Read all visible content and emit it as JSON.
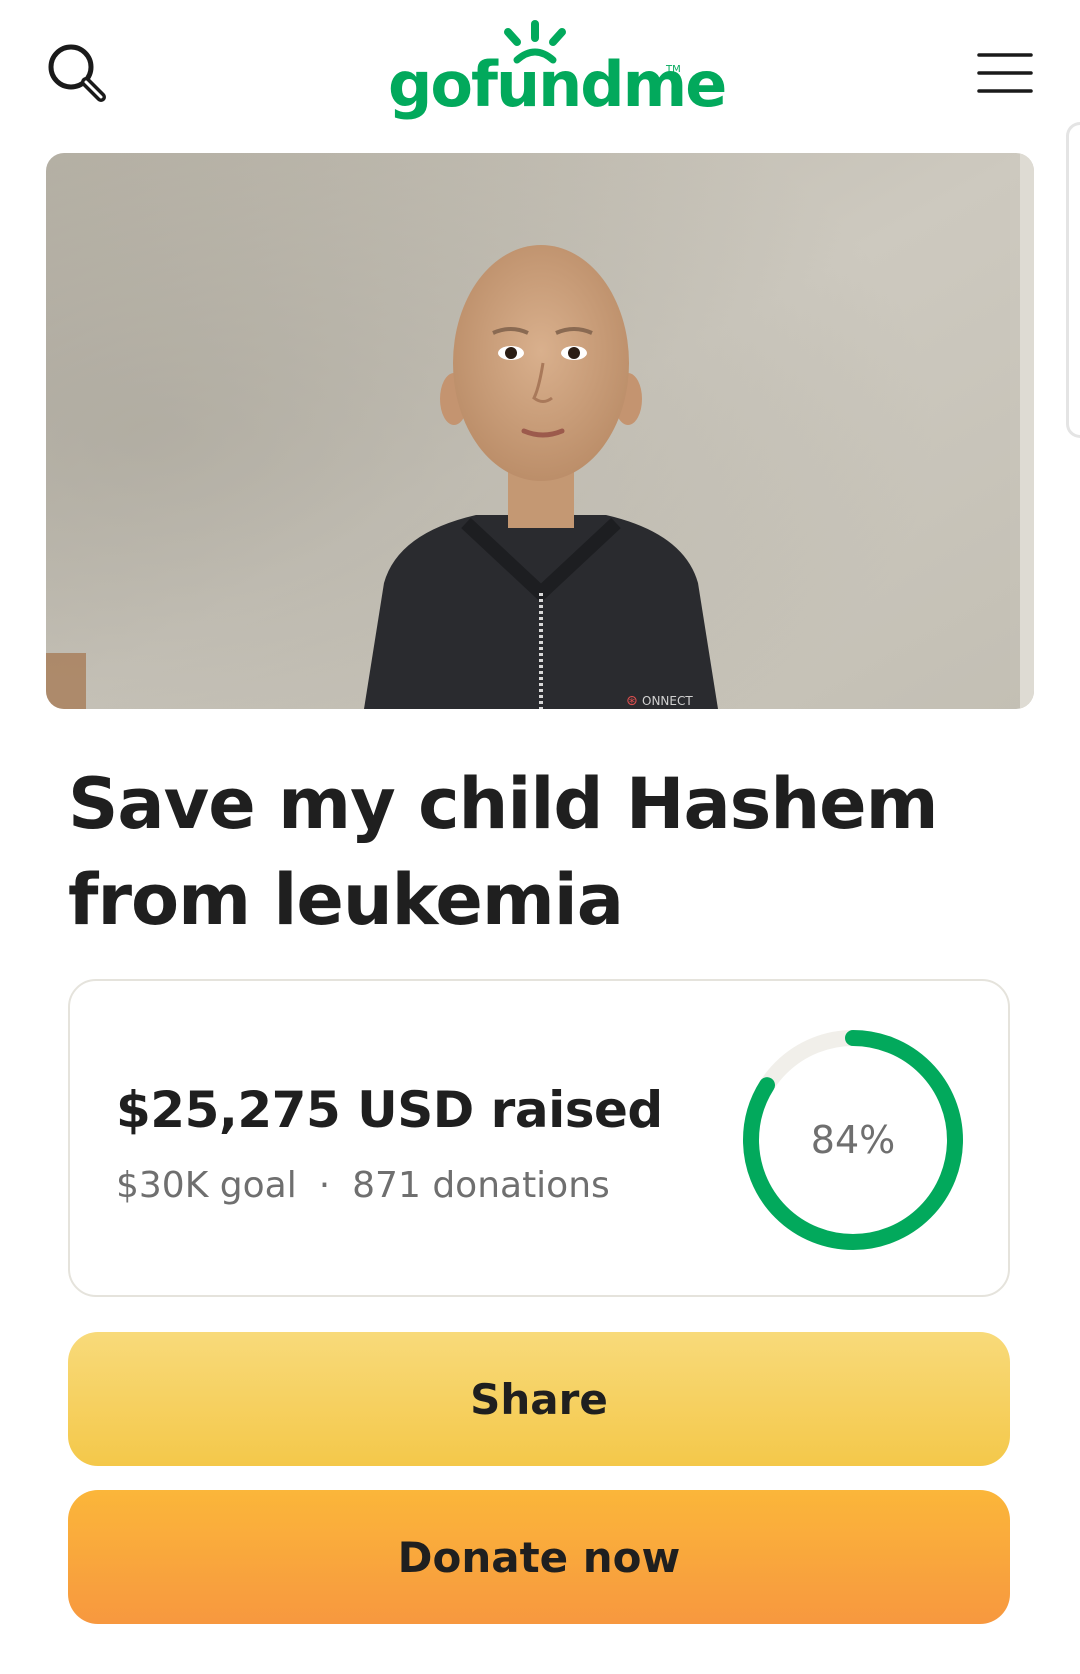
{
  "header": {
    "logo_text": "gofundme",
    "logo_tm": "TM",
    "search_icon": "search-icon",
    "menu_icon": "hamburger-menu-icon"
  },
  "campaign": {
    "image": "campaign-photo-child",
    "title": "Save my child Hashem from leukemia"
  },
  "progress": {
    "raised": "$25,275 USD raised",
    "goal": "$30K goal",
    "separator": "·",
    "donations": "871 donations",
    "percent_label": "84%",
    "percent_value": 84
  },
  "actions": {
    "share_label": "Share",
    "donate_label": "Donate now"
  },
  "colors": {
    "brand_green": "#02a95c",
    "share_yellow": "#f6d264",
    "donate_orange": "#f9a63c",
    "ring_track": "#f1efea"
  }
}
